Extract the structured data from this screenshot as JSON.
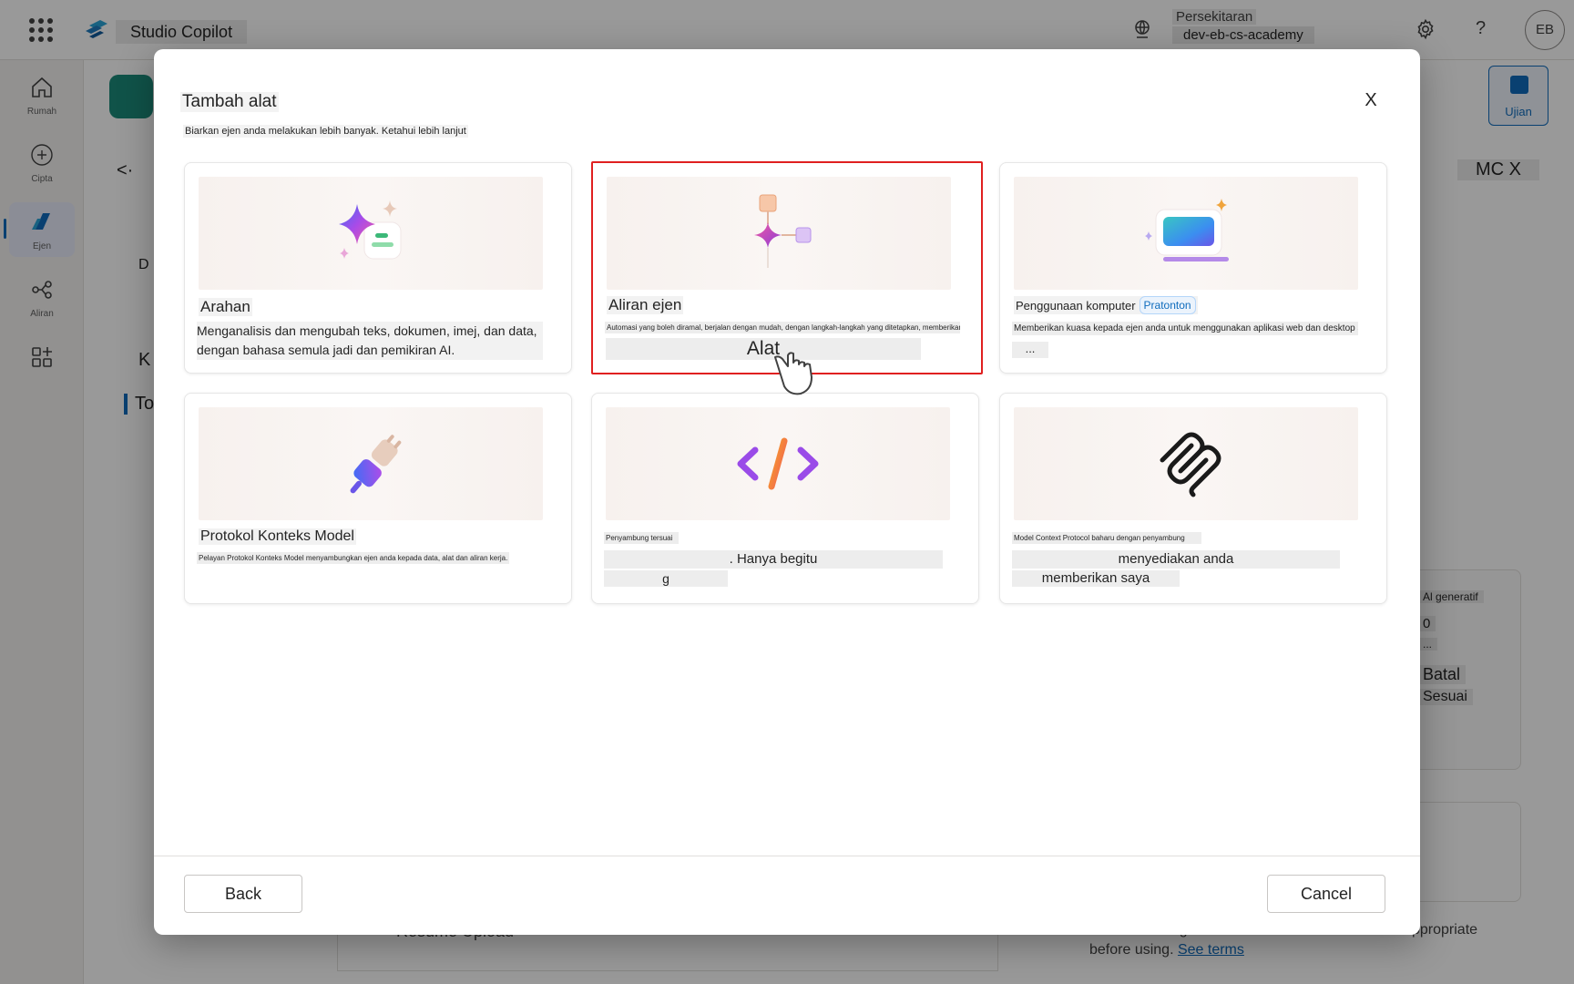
{
  "topbar": {
    "app_title": "Studio Copilot",
    "env_label": "Persekitaran",
    "env_value": "dev-eb-cs-academy",
    "help_glyph": "?",
    "avatar_initials": "EB",
    "icons": [
      "app-launcher-icon",
      "copilot-studio-logo-icon",
      "environment-globe-icon",
      "settings-gear-icon",
      "help-icon"
    ]
  },
  "rail": {
    "items": [
      {
        "label": "Rumah",
        "icon": "home-icon"
      },
      {
        "label": "Cipta",
        "icon": "plus-circle-icon"
      },
      {
        "label": "Ejen",
        "icon": "agent-icon",
        "active": true
      },
      {
        "label": "Aliran",
        "icon": "flow-icon"
      },
      {
        "label": "",
        "icon": "tools-grid-icon"
      }
    ]
  },
  "background": {
    "test_button": "Ujian",
    "mc_label": "MC X",
    "back_arrow": "<·",
    "left_letters": [
      "D",
      "K",
      "To"
    ],
    "panel_labels": [
      "Al generatif",
      "0",
      "...",
      "Batal",
      "Sesuai"
    ],
    "footer_text_1": "Make sure AI-generated content is accurate and appropriate before using.",
    "footer_link": "See terms",
    "resume_item": "Resume Upload"
  },
  "dialog": {
    "title": "Tambah alat",
    "subtitle": "Biarkan ejen anda melakukan lebih banyak. Ketahui lebih lanjut",
    "close_label": "X",
    "cards": [
      {
        "name": "Arahan",
        "icon": "prompt-sparkle-icon",
        "description": "Menganalisis dan mengubah teks, dokumen, imej, dan data, dengan bahasa semula jadi dan pemikiran AI."
      },
      {
        "name": "Aliran ejen",
        "icon": "agent-flow-icon",
        "description": "Automasi yang boleh diramal, berjalan dengan mudah, dengan langkah-langkah yang ditetapkan, memberikan anda lebih kawalan apabila anda memerlukannya",
        "overlay_label": "Alat",
        "selected": true
      },
      {
        "name": "Penggunaan komputer",
        "badge": "Pratonton",
        "icon": "computer-use-icon",
        "description": "Memberikan kuasa kepada ejen anda untuk menggunakan aplikasi web dan desktop secara langsung.",
        "extra": "..."
      },
      {
        "name": "Protokol Konteks Model",
        "icon": "mcp-plug-icon",
        "description": "Pelayan Protokol Konteks Model menyambungkan ejen anda kepada data, alat dan aliran kerja."
      },
      {
        "name": "Penyambung tersuai",
        "icon": "custom-connector-code-icon",
        "line_2": ". Hanya begitu",
        "line_3": "g"
      },
      {
        "name": "Model Context Protocol baharu dengan penyambung",
        "icon": "mcp-logo-icon",
        "line_2": "menyediakan anda",
        "line_3": "memberikan saya"
      }
    ],
    "back_button": "Back",
    "cancel_button": "Cancel"
  },
  "colors": {
    "accent": "#0f6cbd",
    "selection_outline": "#e02020",
    "overlay": "rgba(0,0,0,0.40)"
  }
}
